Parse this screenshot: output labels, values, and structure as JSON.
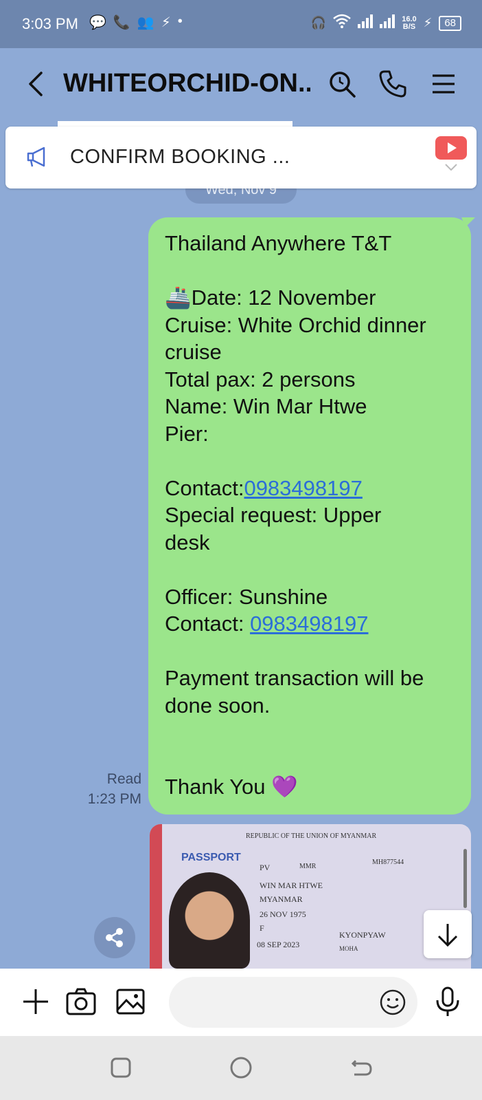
{
  "status_bar": {
    "time": "3:03 PM",
    "net_speed_value": "16.0",
    "net_speed_unit": "B/S",
    "battery": "68"
  },
  "header": {
    "title": "WHITEORCHID-ON..."
  },
  "announcement": {
    "text": "CONFIRM BOOKING ..."
  },
  "date_pill": "Wed, Nov 9",
  "message": {
    "lines": [
      "Thailand Anywhere T&T",
      "",
      "🚢Date: 12 November",
      "Cruise: White Orchid dinner",
      "cruise",
      "Total pax: 2 persons",
      "Name: Win Mar Htwe",
      "Pier:",
      "",
      "Contact:",
      "Special request: Upper",
      "desk",
      "",
      "Officer: Sunshine",
      "Contact: ",
      "",
      "Payment transaction will be",
      "done soon.",
      "",
      "",
      "Thank You 💜"
    ],
    "contact_link_1": "0983498197",
    "contact_link_2": "0983498197",
    "read_status": "Read",
    "sent_time": "1:23 PM"
  },
  "passport": {
    "header": "REPUBLIC OF THE UNION OF MYANMAR",
    "label": "PASSPORT",
    "type": "PV",
    "country_code": "MMR",
    "passport_no": "MH877544",
    "name": "WIN MAR HTWE",
    "nationality": "MYANMAR",
    "dob": "26 NOV 1975",
    "sex": "F",
    "place_of_birth": "KYONPYAW",
    "issue_date": "08 SEP 2023",
    "authority": "MOHA"
  },
  "colors": {
    "chat_bg": "#8eaad6",
    "bubble": "#9be58b",
    "status_bar": "#6d86ae",
    "link": "#2b6ed8"
  }
}
